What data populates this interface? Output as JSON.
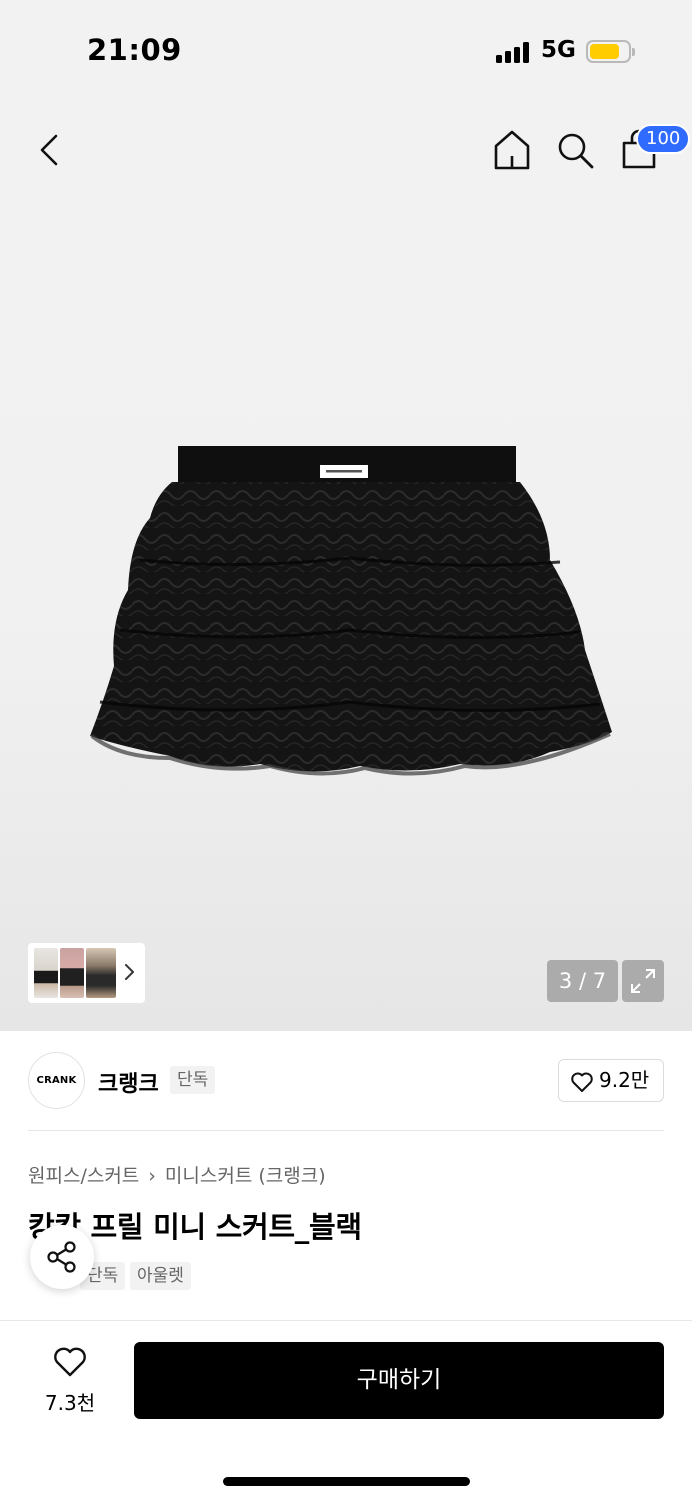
{
  "status_bar": {
    "time": "21:09",
    "network": "5G",
    "battery_level": 0.75,
    "battery_color": "#ffcc00",
    "icons": [
      "signal-icon",
      "battery-icon"
    ]
  },
  "nav": {
    "icons": [
      "back-arrow-icon",
      "home-icon",
      "search-icon",
      "shopping-bag-icon"
    ],
    "cart_count": "100",
    "badge_color": "#2f6bff"
  },
  "gallery": {
    "current": "3 / 7",
    "icons": [
      "chevron-right-icon",
      "expand-icon"
    ]
  },
  "brand": {
    "logo_text": "CRANK",
    "name": "크랭크",
    "tag": "단독",
    "likes": "9.2만",
    "icons": [
      "heart-outline-icon"
    ]
  },
  "product": {
    "breadcrumb": [
      "원피스/스커트",
      "미니스커트 (크랭크)"
    ],
    "title": "캉캉 프릴 미니 스커트_블랙",
    "tags": [
      "단독",
      "아울렛"
    ],
    "icons": [
      "share-icon"
    ]
  },
  "bottom_bar": {
    "wish_count": "7.3천",
    "buy_label": "구매하기",
    "icons": [
      "heart-outline-icon"
    ]
  }
}
